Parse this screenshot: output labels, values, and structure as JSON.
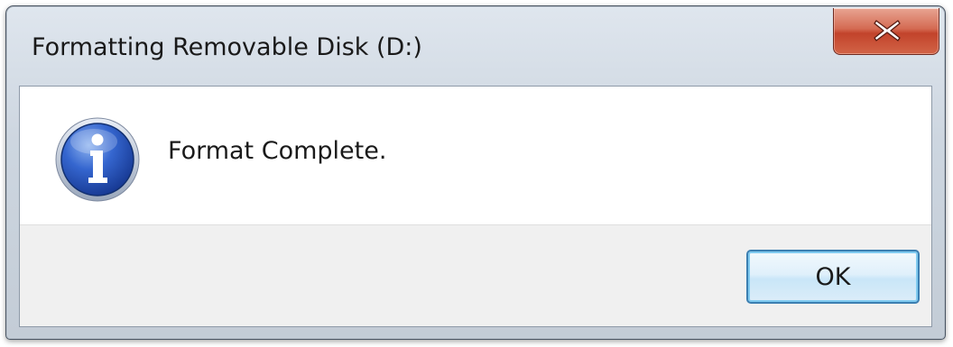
{
  "window": {
    "title": "Formatting Removable Disk (D:)",
    "close_icon": "close-x-icon"
  },
  "message": {
    "icon": "information-icon",
    "text": "Format Complete."
  },
  "buttons": {
    "ok_label": "OK"
  },
  "colors": {
    "close_button": "#c94a30",
    "info_icon_blue": "#1f4fb4",
    "ok_button_border": "#3c7fb1",
    "button_strip": "#f0f0f0"
  }
}
